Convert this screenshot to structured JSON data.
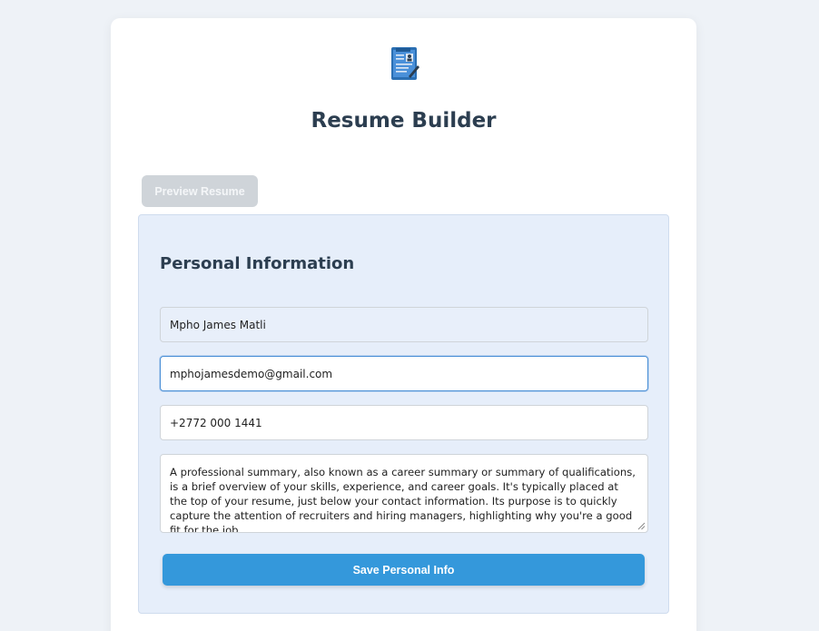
{
  "app": {
    "title": "Resume Builder",
    "logo_icon": "resume-document-icon"
  },
  "toolbar": {
    "preview_label": "Preview Resume"
  },
  "personal_info": {
    "heading": "Personal Information",
    "name_value": "Mpho James Matli",
    "email_value": "mphojamesdemo@gmail.com",
    "phone_value": "+2772 000 1441",
    "summary_value": "A professional summary, also known as a career summary or summary of qualifications, is a brief overview of your skills, experience, and career goals. It's typically placed at the top of your resume, just below your contact information. Its purpose is to quickly capture the attention of recruiters and hiring managers, highlighting why you're a good fit for the job.",
    "save_label": "Save Personal Info"
  },
  "colors": {
    "accent": "#3498db",
    "heading": "#2c3e50",
    "section_bg": "#e6eefa",
    "page_bg": "#eef2f7",
    "disabled_button": "#cfd4d9"
  }
}
